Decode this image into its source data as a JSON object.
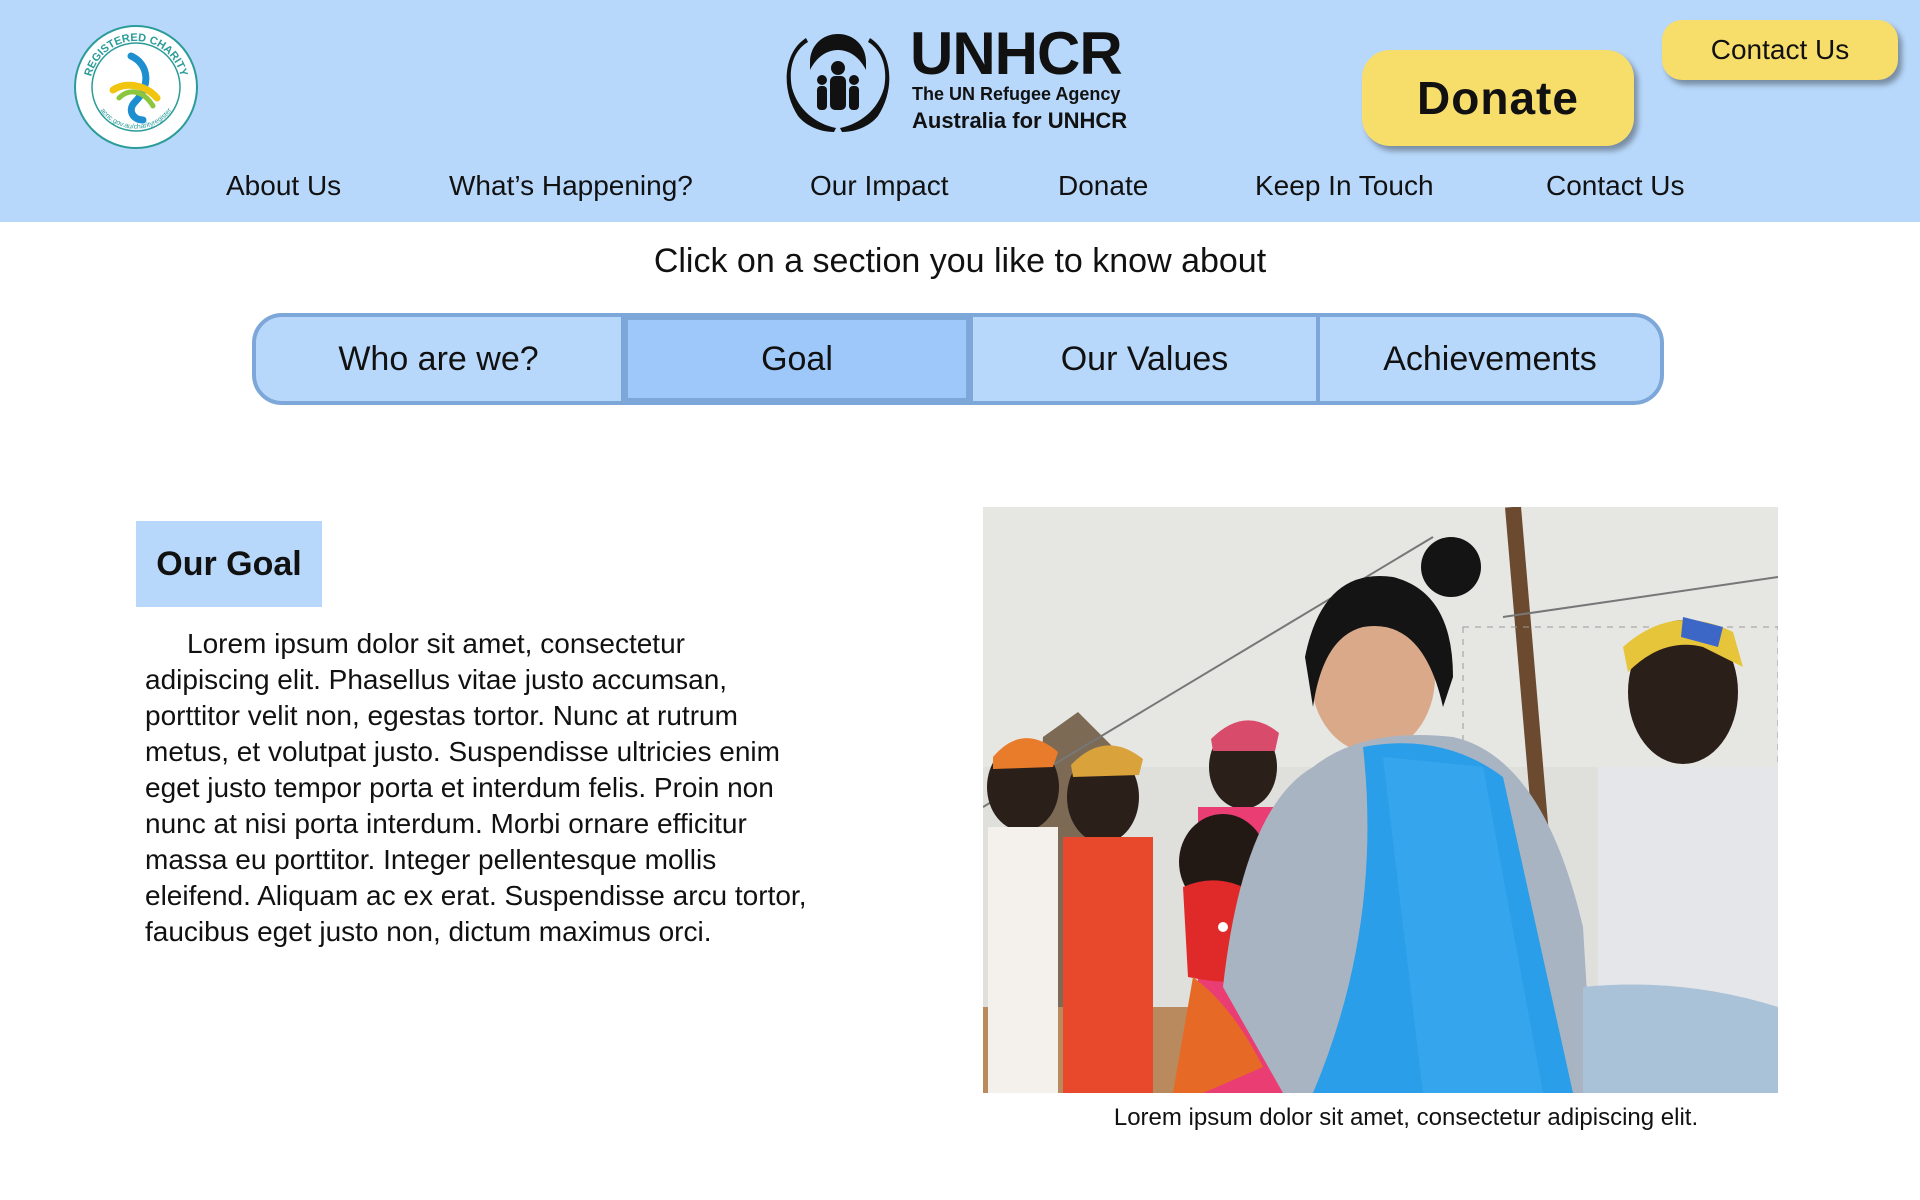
{
  "header": {
    "charity_badge": {
      "icon": "registered-charity-badge",
      "text_top": "REGISTERED CHARITY",
      "text_bottom": "acnc.gov.au/charityregister"
    },
    "logo": {
      "icon": "unhcr-emblem-icon",
      "name": "UNHCR",
      "subtitle": "The UN Refugee Agency",
      "subtitle2": "Australia for UNHCR"
    },
    "donate_label": "Donate",
    "contact_label": "Contact Us",
    "colors": {
      "header_bg": "#b8d8fb",
      "button_bg": "#f7dd6a"
    }
  },
  "nav": {
    "items": [
      {
        "label": "About Us"
      },
      {
        "label": "What’s Happening?"
      },
      {
        "label": "Our Impact"
      },
      {
        "label": "Donate"
      },
      {
        "label": "Keep In Touch"
      },
      {
        "label": "Contact Us"
      }
    ]
  },
  "main": {
    "intro": "Click on a section you like to know about",
    "tabs": [
      {
        "label": "Who are we?",
        "active": false
      },
      {
        "label": "Goal",
        "active": true
      },
      {
        "label": "Our Values",
        "active": false
      },
      {
        "label": "Achievements",
        "active": false
      }
    ],
    "section": {
      "heading": "Our Goal",
      "body": "Lorem ipsum dolor sit amet, consectetur adipiscing elit. Phasellus vitae justo accumsan, porttitor velit non, egestas tortor. Nunc at rutrum metus, et volutpat justo. Suspendisse ultricies enim eget justo tempor porta et interdum felis. Proin non nunc at nisi porta interdum. Morbi ornare efficitur massa eu porttitor. Integer pellentesque mollis eleifend. Aliquam ac ex erat. Suspendisse arcu tortor, faucibus eget justo non, dictum maximus orci."
    },
    "photo": {
      "caption": "Lorem ipsum dolor sit amet, consectetur adipiscing elit."
    }
  }
}
